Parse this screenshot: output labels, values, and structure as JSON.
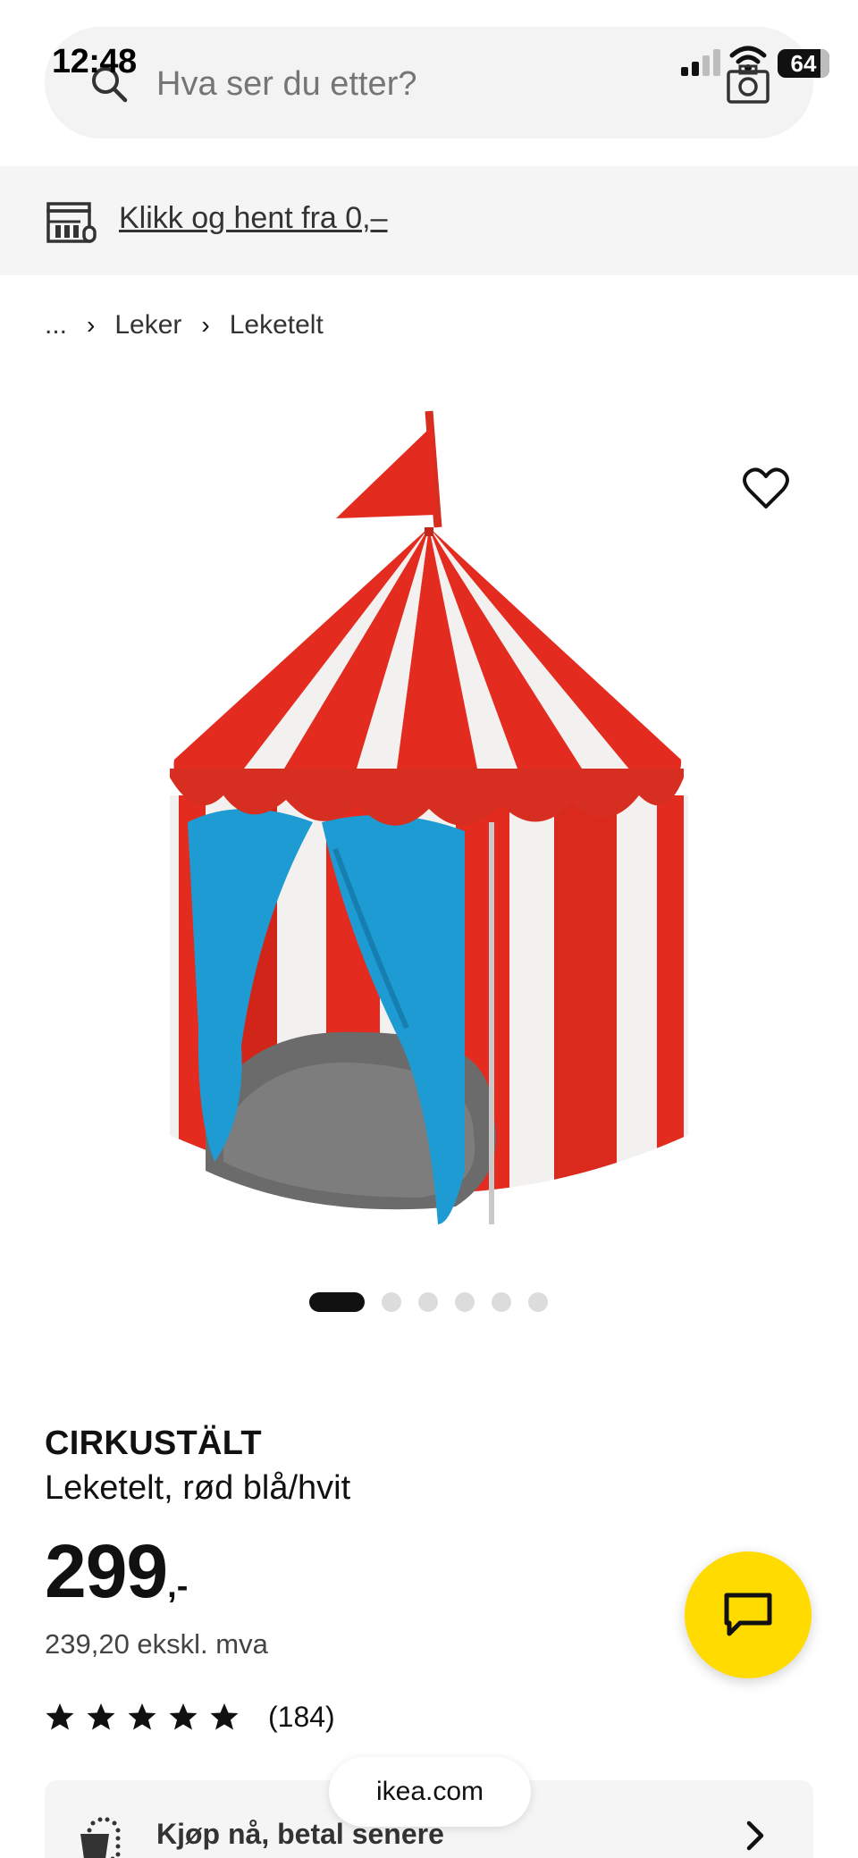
{
  "status_bar": {
    "time": "12:48",
    "battery": "64"
  },
  "search": {
    "placeholder": "Hva ser du etter?"
  },
  "pickup_banner": {
    "text": "Klikk og hent fra 0,–"
  },
  "breadcrumb": {
    "ellipsis": "...",
    "items": [
      "Leker",
      "Leketelt"
    ]
  },
  "carousel": {
    "total": 6,
    "active": 1
  },
  "product": {
    "name": "CIRKUSTÄLT",
    "description": "Leketelt, rød blå/hvit",
    "price": "299",
    "price_suffix": ",-",
    "price_ex_vat": "239,20 ekskl. mva",
    "rating_stars": 5,
    "rating_count": "(184)"
  },
  "bnpl": {
    "label": "Kjøp nå, betal senere"
  },
  "browser": {
    "url": "ikea.com"
  },
  "colors": {
    "chat_button": "#ffdb00",
    "tent_red": "#e42b1f",
    "tent_blue": "#1d9bd2"
  }
}
